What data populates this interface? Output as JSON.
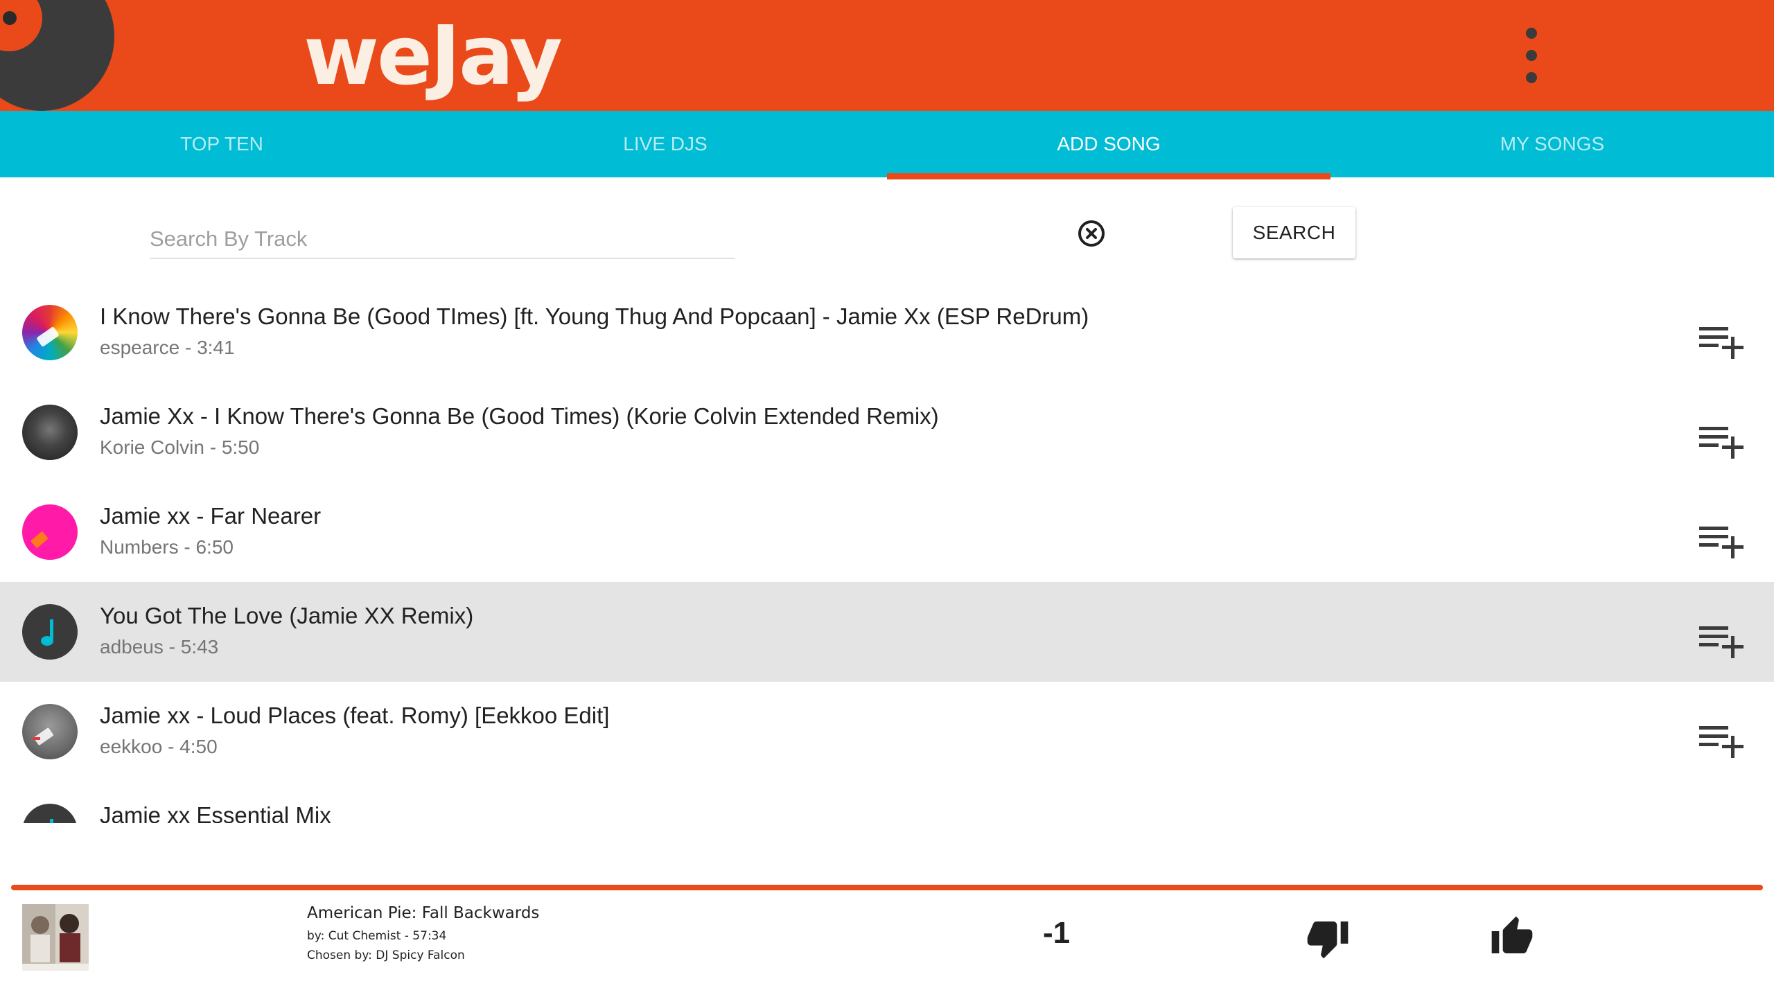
{
  "app": {
    "title": "weJay"
  },
  "header": {
    "menu_icon": "more-vert-icon",
    "logo_icon": "vinyl-record-icon"
  },
  "tabs": [
    {
      "label": "TOP TEN",
      "active": false
    },
    {
      "label": "LIVE DJS",
      "active": false
    },
    {
      "label": "ADD SONG",
      "active": true
    },
    {
      "label": "MY SONGS",
      "active": false
    }
  ],
  "search": {
    "placeholder": "Search By Track",
    "value": "",
    "clear_icon": "clear-circle-icon",
    "button_label": "SEARCH"
  },
  "results": [
    {
      "title": "I Know There's Gonna Be (Good TImes) [ft. Young Thug And Popcaan] - Jamie Xx (ESP ReDrum)",
      "meta": "espearce - 3:41",
      "artwork": "rainbow-artwork",
      "selected": false
    },
    {
      "title": "Jamie Xx - I Know There's Gonna Be (Good Times) (Korie Colvin Extended Remix)",
      "meta": "Korie Colvin - 5:50",
      "artwork": "dark-photo-artwork",
      "selected": false
    },
    {
      "title": "Jamie xx - Far Nearer",
      "meta": "Numbers - 6:50",
      "artwork": "pink-artwork",
      "selected": false
    },
    {
      "title": "You Got The Love (Jamie XX Remix)",
      "meta": "adbeus - 5:43",
      "artwork": "music-note-icon",
      "selected": true
    },
    {
      "title": "Jamie xx - Loud Places (feat. Romy) [Eekkoo Edit]",
      "meta": "eekkoo - 4:50",
      "artwork": "grey-artwork",
      "selected": false
    },
    {
      "title": "Jamie xx Essential Mix",
      "meta": "",
      "artwork": "music-note-icon",
      "selected": false
    }
  ],
  "add_icon": "playlist-add-icon",
  "now_playing": {
    "title": "American Pie: Fall Backwards",
    "by": "by: Cut Chemist - 57:34",
    "chosen_by": "Chosen by: DJ Spicy Falcon",
    "score": "-1",
    "dislike_icon": "thumb-down-icon",
    "like_icon": "thumb-up-icon"
  },
  "colors": {
    "header": "#EA4A1A",
    "tabs": "#00BCD4",
    "accent": "#EA4A1A",
    "selected_row": "#E4E4E4"
  }
}
